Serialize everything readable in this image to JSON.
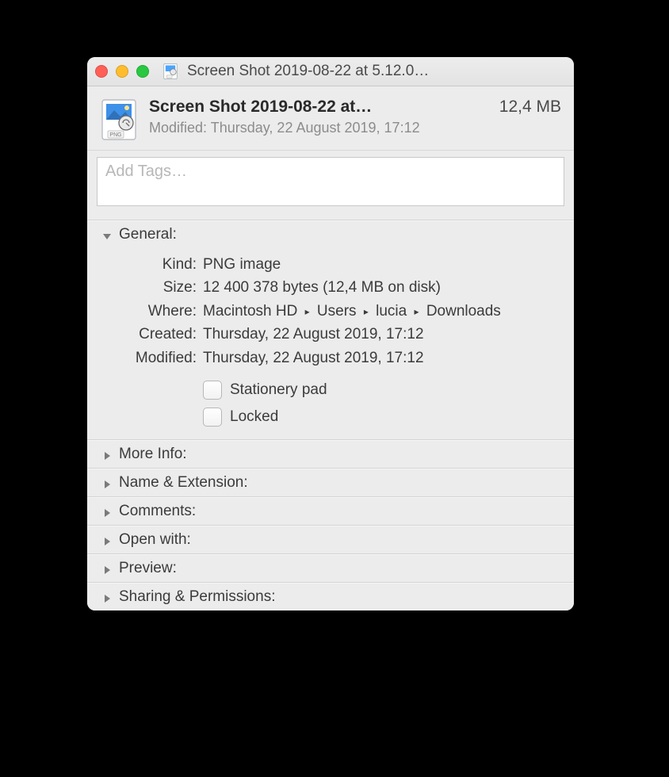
{
  "window": {
    "title": "Screen Shot 2019-08-22 at 5.12.0…"
  },
  "header": {
    "file_name": "Screen Shot 2019-08-22 at…",
    "file_size": "12,4 MB",
    "modified_label": "Modified:",
    "modified_value": "Thursday, 22 August 2019, 17:12"
  },
  "tags": {
    "placeholder": "Add Tags…"
  },
  "sections": {
    "general": {
      "title": "General:",
      "kind_label": "Kind:",
      "kind_value": "PNG image",
      "size_label": "Size:",
      "size_value": "12 400 378 bytes (12,4 MB on disk)",
      "where_label": "Where:",
      "where_parts": [
        "Macintosh HD",
        "Users",
        "lucia",
        "Downloads"
      ],
      "created_label": "Created:",
      "created_value": "Thursday, 22 August 2019, 17:12",
      "modified_label": "Modified:",
      "modified_value": "Thursday, 22 August 2019, 17:12",
      "stationery_label": "Stationery pad",
      "locked_label": "Locked"
    },
    "more_info": {
      "title": "More Info:"
    },
    "name_ext": {
      "title": "Name & Extension:"
    },
    "comments": {
      "title": "Comments:"
    },
    "open_with": {
      "title": "Open with:"
    },
    "preview": {
      "title": "Preview:"
    },
    "sharing": {
      "title": "Sharing & Permissions:"
    }
  }
}
